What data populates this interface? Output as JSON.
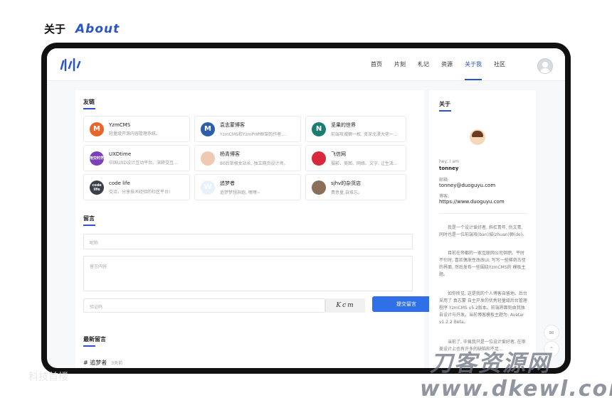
{
  "heading": {
    "cn": "关于",
    "en": "About"
  },
  "nav": [
    "首页",
    "片刻",
    "札记",
    "资源",
    "关于我",
    "社区"
  ],
  "nav_active": "关于我",
  "sections": {
    "links_title": "友链",
    "message_title": "留言",
    "latest_title": "最新留言"
  },
  "links": [
    {
      "name": "YzmCMS",
      "desc": "轻量级开源内容管理系统。",
      "logo_text": "M",
      "color": "#e8662b"
    },
    {
      "name": "袁志蒙博客",
      "desc": "YzmCMS和YzmPHP框架的作者,...",
      "logo_text": "M",
      "color": "#2c5fa8"
    },
    {
      "name": "坚果的世界",
      "desc": "前端攻城狮一枚, 资深北漂大佬一...",
      "logo_text": "N",
      "color": "#1d7d70"
    },
    {
      "name": "UXDtime",
      "desc": "中国UXD设计互动平台。深耕交互...",
      "logo_text": "用交时界",
      "color": "#7b3fb7"
    },
    {
      "name": "杨青博客",
      "desc": "80后草根女站长, 独立网页设计师。",
      "logo_text": "",
      "color": "#f0c9b4"
    },
    {
      "name": "飞信网",
      "desc": "摄影、美图、网络、文字, 让生活...",
      "logo_text": "",
      "color": "#d8283c"
    },
    {
      "name": "code life",
      "desc": "交流、分享技术经验的社区平台!",
      "logo_text": "code life",
      "color": "#3a3f4b"
    },
    {
      "name": "追梦者",
      "desc": "追梦梦想奔跑, 嘿嘿~",
      "logo_text": "W",
      "color": "#e7f0fb"
    },
    {
      "name": "sjhv的杂货店",
      "desc": "费意量,自难忘。",
      "logo_text": "",
      "color": "#8a6f5a"
    }
  ],
  "form": {
    "nickname_placeholder": "昵称",
    "content_placeholder": "留言内容",
    "captcha_placeholder": "验证码",
    "captcha_text": "Kcm",
    "submit_label": "提交留言"
  },
  "latest": {
    "author": "# 追梦者",
    "time": "3天前"
  },
  "sidebar": {
    "title": "关于",
    "greeting": "hey, I am",
    "name": "tonney",
    "email_label": "邮箱:",
    "email": "tonney@duoguyu.com",
    "blog_label": "博客:",
    "blog": "https://www.duoguyu.com",
    "paragraphs": [
      "我是一个设计爱好者, 斜杠青年, 伪文青, 同时也是一位前端攻(ban)城(zhuan)狮(de)。",
      "目前在帝都的一家互联网公司供职。平时不忙时, 喜欢偶发性改改UI, 写写一些稀奇古怪的界面, 然后发布一些围绕YzmCMS的 模板主题。",
      "如你所见, 这是我的个人博客自留地。后台采用了 袁志蒙 自主开发的优秀轻量级后台管理程序 YzmCMS v5.2版本。前端界面则由我独自设计与开发。当前博客模板主题为: Avatar v1.2.2 Beta。",
      "当前了, 毕竟我只是一位设计爱好者, 在审美设计上也有许多的缺陷和不足..."
    ]
  },
  "watermark": {
    "cn": "刀客资源网",
    "url": "www.dkewl.com",
    "left": "科技首楼"
  },
  "colors": {
    "accent": "#2a55c8",
    "button": "#2f6fe8"
  }
}
